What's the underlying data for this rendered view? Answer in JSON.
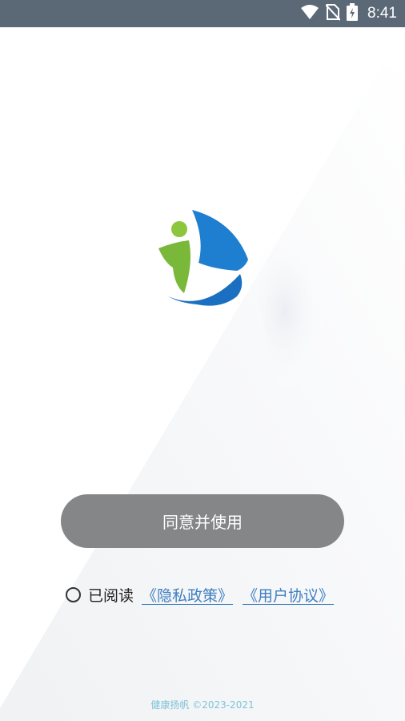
{
  "status_bar": {
    "time": "8:41",
    "icons": [
      "wifi-icon",
      "no-sim-icon",
      "battery-charging-icon"
    ]
  },
  "colors": {
    "status_bar_bg": "#5b6977",
    "button_bg": "#858687",
    "link": "#3f7fc1",
    "footer_text": "#7fc4d8",
    "logo_green": "#8cc63f",
    "logo_blue": "#1e7fd1"
  },
  "logo": {
    "icon": "sailboat-person-logo"
  },
  "main": {
    "agree_button_label": "同意并使用",
    "read_label": "已阅读",
    "privacy_link": "《隐私政策》",
    "user_agreement_link": "《用户协议》"
  },
  "footer": {
    "copyright": "健康扬帆 ©2023-2021"
  }
}
